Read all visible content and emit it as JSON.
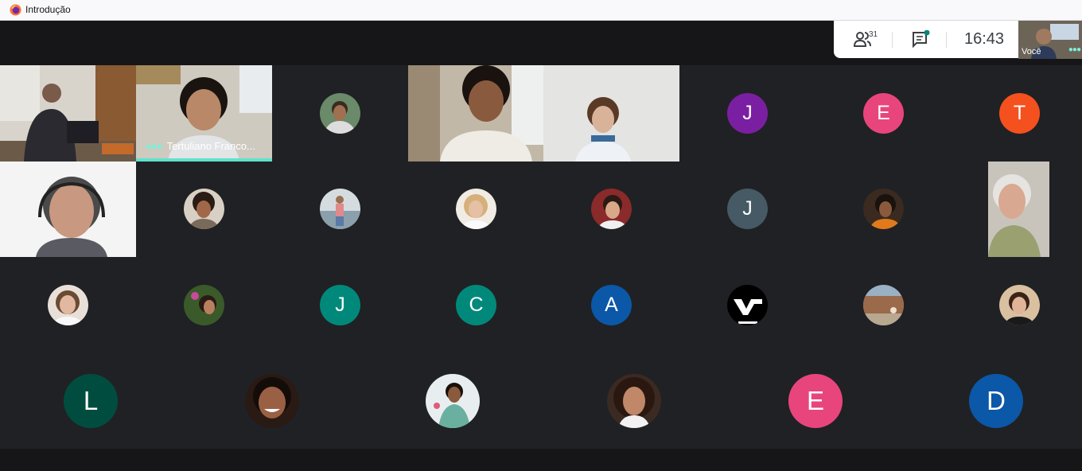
{
  "window": {
    "title": "Introdução",
    "icon": "firefox-icon"
  },
  "toolbar": {
    "participants_icon": "people-icon",
    "participants_count": "31",
    "chat_icon": "chat-icon",
    "time": "16:43"
  },
  "self_view": {
    "label": "Você"
  },
  "video_tiles": [
    {
      "name": ""
    },
    {
      "name": "Tertuliano Franco...",
      "speaking": true
    },
    {
      "name": ""
    },
    {
      "name": ""
    },
    {
      "name": ""
    },
    {
      "name": ""
    }
  ],
  "avatars": {
    "r1_j": "J",
    "r1_e": "E",
    "r1_t": "T",
    "r2_j": "J",
    "r3_j": "J",
    "r3_c": "C",
    "r3_a": "A",
    "r4_l": "L",
    "r4_e": "E",
    "r4_d": "D"
  },
  "colors": {
    "background": "#202124",
    "speaking_accent": "#5fe3cc",
    "purple": "#7b1fa2",
    "pink": "#e8457c",
    "orange": "#f4511e",
    "slate": "#455a64",
    "teal": "#00897b",
    "blue": "#0b57a8",
    "green": "#004d40"
  }
}
